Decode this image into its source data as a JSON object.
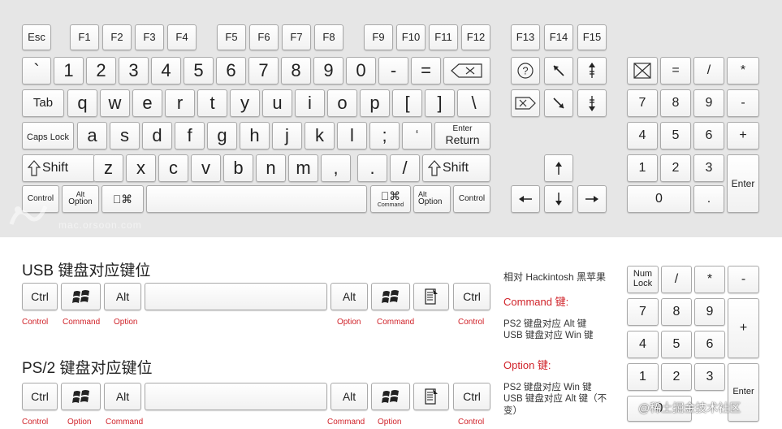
{
  "mac_keyboard": {
    "function_row": [
      "Esc",
      "F1",
      "F2",
      "F3",
      "F4",
      "F5",
      "F6",
      "F7",
      "F8",
      "F9",
      "F10",
      "F11",
      "F12",
      "F13",
      "F14",
      "F15"
    ],
    "number_row": [
      "`",
      "1",
      "2",
      "3",
      "4",
      "5",
      "6",
      "7",
      "8",
      "9",
      "0",
      "-",
      "="
    ],
    "top_row": [
      "Tab",
      "q",
      "w",
      "e",
      "r",
      "t",
      "y",
      "u",
      "i",
      "o",
      "p",
      "[",
      "]",
      "\\"
    ],
    "home_row": [
      "Caps Lock",
      "a",
      "s",
      "d",
      "f",
      "g",
      "h",
      "j",
      "k",
      "l",
      ";",
      "‘"
    ],
    "enter_return": {
      "top": "Enter",
      "bottom": "Return"
    },
    "bottom_letter_row": [
      "Shift",
      "z",
      "x",
      "c",
      "v",
      "b",
      "n",
      "m",
      ",",
      ".",
      "/",
      "Shift"
    ],
    "modifier_row": {
      "left_control": "Control",
      "left_alt_top": "Alt",
      "left_option": "Option",
      "right_command": "Command",
      "right_alt_top": "Alt",
      "right_option": "Option",
      "right_control": "Control"
    },
    "numpad": [
      "=",
      "/",
      "*",
      "7",
      "8",
      "9",
      "-",
      "4",
      "5",
      "6",
      "+",
      "1",
      "2",
      "3",
      "Enter",
      "0",
      "."
    ],
    "watermark_url": "mac.orsoon.com"
  },
  "usb_section": {
    "title": "USB 键盘对应键位",
    "keys": {
      "ctrl_left": "Ctrl",
      "alt_left": "Alt",
      "alt_right": "Alt",
      "ctrl_right": "Ctrl"
    },
    "mappings_left": [
      "Control",
      "Command",
      "Option"
    ],
    "mappings_right": [
      "Option",
      "Command",
      "Control"
    ]
  },
  "ps2_section": {
    "title": "PS/2 键盘对应键位",
    "keys": {
      "ctrl_left": "Ctrl",
      "alt_left": "Alt",
      "alt_right": "Alt",
      "ctrl_right": "Ctrl"
    },
    "mappings_left": [
      "Control",
      "Option",
      "Command"
    ],
    "mappings_right": [
      "Command",
      "Option",
      "Control"
    ]
  },
  "notes": {
    "header": "相对 Hackintosh 黑苹果",
    "command_title": "Command 键:",
    "command_body": "PS2 键盘对应 Alt 键\nUSB 键盘对应 Win 键",
    "option_title": "Option 键:",
    "option_body": "PS2 键盘对应 Win 键\nUSB 键盘对应 Alt 键（不\n变）"
  },
  "pc_numpad": {
    "keys": [
      "Num\nLock",
      "/",
      "*",
      "-",
      "7",
      "8",
      "9",
      "+",
      "4",
      "5",
      "6",
      "1",
      "2",
      "3",
      "Enter",
      "0"
    ]
  },
  "footer_watermark": "@稀土掘金技术社区",
  "colors": {
    "panel": "#e6e6e6",
    "key_border": "#a9a9a9",
    "accent_red": "#d0232a"
  }
}
